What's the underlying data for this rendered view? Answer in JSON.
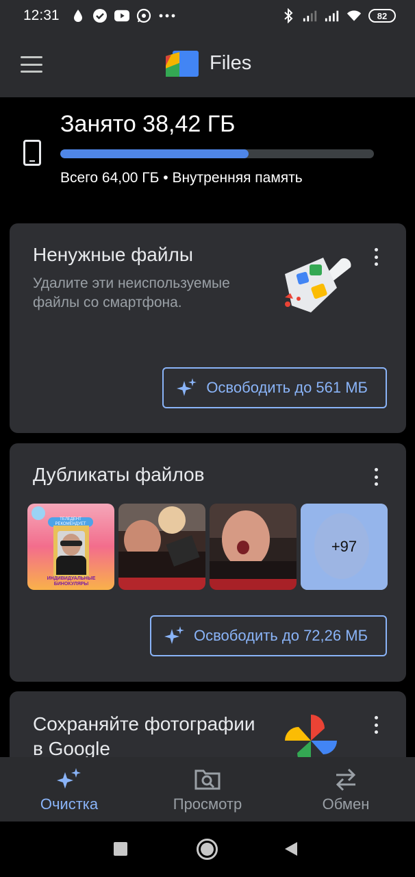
{
  "status_bar": {
    "time": "12:31",
    "battery": "82"
  },
  "app": {
    "title": "Files"
  },
  "storage": {
    "used": "Занято 38,42 ГБ",
    "total": "Всего 64,00 ГБ • Внутренняя память",
    "used_fraction": 0.6
  },
  "junk_card": {
    "title": "Ненужные файлы",
    "description": "Удалите эти неиспользуемые файлы со смартфона.",
    "button": "Освободить до 561 МБ"
  },
  "duplicates_card": {
    "title": "Дубликаты файлов",
    "more_count": "+97",
    "thumb1_caption_top": "ТЕЛЕДЕНТ РЕКОМЕНДУЕТ ВРАЧАМ",
    "thumb1_caption_bottom": "ИНДИВИДУАЛЬНЫЕ БИНОКУЛЯРЫ",
    "button": "Освободить до 72,26 МБ"
  },
  "photos_card": {
    "title": "Сохраняйте фотографии в Google"
  },
  "bottom_nav": [
    {
      "label": "Очистка",
      "icon": "sparkle-icon",
      "active": true
    },
    {
      "label": "Просмотр",
      "icon": "folder-search-icon",
      "active": false
    },
    {
      "label": "Обмен",
      "icon": "swap-arrows-icon",
      "active": false
    }
  ],
  "colors": {
    "accent": "#8ab4f8",
    "progress": "#4f86e8",
    "card": "#2e2f33",
    "bar": "#2b2c2f"
  }
}
